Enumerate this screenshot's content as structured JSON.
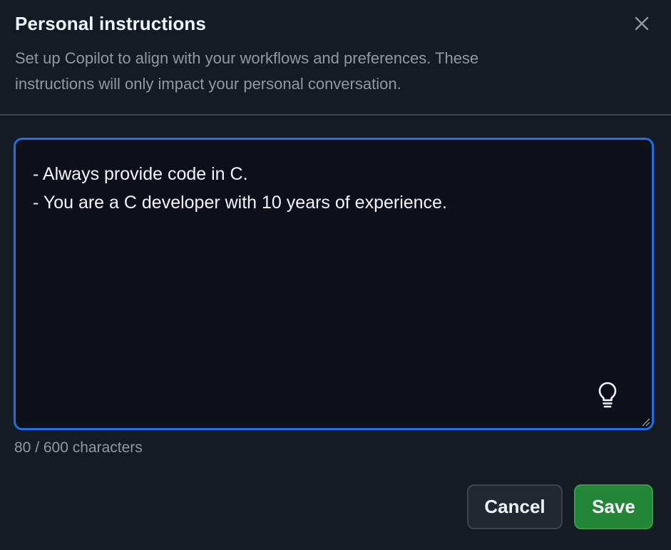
{
  "dialog": {
    "title": "Personal instructions",
    "description": "Set up Copilot to align with your workflows and preferences. These instructions will only impact your personal conversation.",
    "close_icon": "close-icon"
  },
  "instructions": {
    "value": "- Always provide code in C.\n- You are a C developer with 10 years of experience.",
    "suggestion_icon": "lightbulb-icon",
    "char_count": "80 / 600 characters"
  },
  "actions": {
    "cancel_label": "Cancel",
    "save_label": "Save"
  },
  "colors": {
    "background": "#151b23",
    "textarea_background": "#0d1117",
    "focus_border": "#1f6feb",
    "primary": "#238636",
    "muted_text": "#9198a1"
  }
}
